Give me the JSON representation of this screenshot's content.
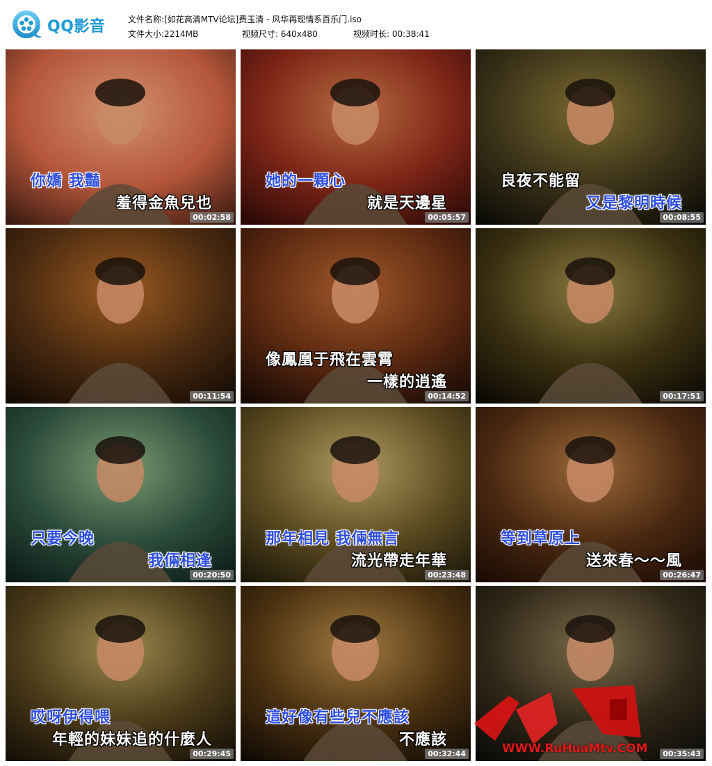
{
  "app": {
    "name": "QQ影音"
  },
  "file_info": {
    "name_label": "文件名称:",
    "name_value": "[如花高清MTV论坛]费玉清 - 风华再现情系百乐门.iso",
    "size_label": "文件大小:",
    "size_value": "2214MB",
    "dims_label": "视频尺寸:",
    "dims_value": "640x480",
    "duration_label": "视频时长:",
    "duration_value": "00:38:41"
  },
  "thumbnails": [
    {
      "time": "00:02:58",
      "line1": "你嬌 我豔",
      "line2": "羞得金魚兒也",
      "hl": [
        true,
        false
      ]
    },
    {
      "time": "00:05:57",
      "line1": "她的一顆心",
      "line2": "就是天邊星",
      "hl": [
        true,
        false
      ]
    },
    {
      "time": "00:08:55",
      "line1": "良夜不能留",
      "line2": "又是黎明時候",
      "hl": [
        false,
        true
      ]
    },
    {
      "time": "00:11:54",
      "line1": "",
      "line2": "",
      "hl": [
        false,
        false
      ]
    },
    {
      "time": "00:14:52",
      "line1": "像鳳凰于飛在雲霄",
      "line2": "一樣的逍遙",
      "hl": [
        false,
        false
      ]
    },
    {
      "time": "00:17:51",
      "line1": "",
      "line2": "",
      "hl": [
        false,
        false
      ]
    },
    {
      "time": "00:20:50",
      "line1": "只要今晚",
      "line2": "我倆相逢",
      "hl": [
        true,
        true
      ]
    },
    {
      "time": "00:23:48",
      "line1": "那年相見 我倆無言",
      "line2": "流光帶走年華",
      "hl": [
        true,
        false
      ]
    },
    {
      "time": "00:26:47",
      "line1": "等到草原上",
      "line2": "送來春～～風",
      "hl": [
        true,
        false
      ]
    },
    {
      "time": "00:29:45",
      "line1": "哎呀伊得喂",
      "line2": "年輕的妹妹追的什麼人",
      "hl": [
        true,
        false
      ]
    },
    {
      "time": "00:32:44",
      "line1": "這好像有些兒不應該",
      "line2": "不應該",
      "hl": [
        true,
        false
      ]
    },
    {
      "time": "00:35:43",
      "line1": "",
      "line2": "",
      "hl": [
        false,
        false
      ]
    }
  ],
  "watermark": {
    "text": "如花",
    "url": "WWW.RuHuaMtv.COM",
    "color": "#e01818"
  },
  "colors": {
    "accent": "#1c9ad6",
    "subtitle_highlight": "#2f4fe0"
  }
}
